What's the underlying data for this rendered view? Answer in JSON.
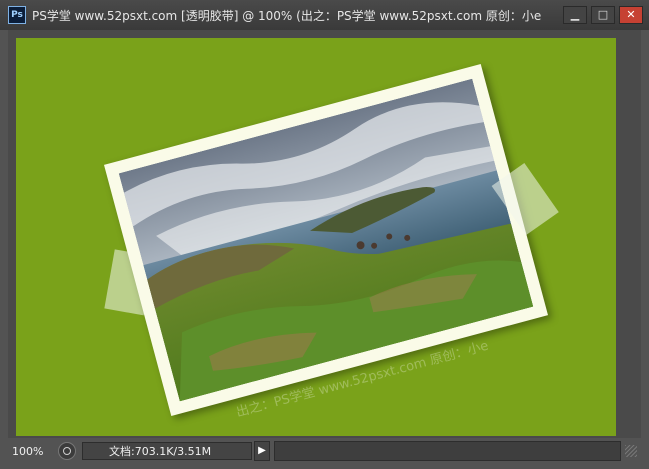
{
  "window": {
    "title": "PS学堂 www.52psxt.com [透明胶带] @ 100% (出之：PS学堂 www.52psxt.com   原创：小e"
  },
  "controls": {
    "minimize": "▁",
    "maximize": "□",
    "close": "✕"
  },
  "canvas": {
    "background_color": "#7aa21a",
    "watermark": "出之：PS学堂 www.52psxt.com   原创：小e"
  },
  "status": {
    "zoom": "100%",
    "doc_info": "文档:703.1K/3.51M",
    "play_icon": "▶"
  },
  "icons": [
    "ps-logo-icon",
    "status-circle-icon",
    "play-icon",
    "resize-grip-icon"
  ]
}
